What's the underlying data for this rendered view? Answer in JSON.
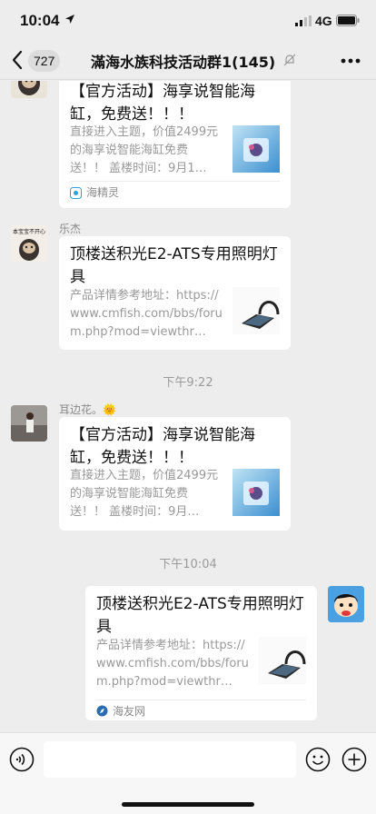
{
  "status_bar": {
    "time": "10:04",
    "network": "4G"
  },
  "header": {
    "back_count": "727",
    "title": "滿海水族科技活动群1(145)"
  },
  "messages": [
    {
      "type": "link_card",
      "title": "【官方活动】海享说智能海缸，免费送！！！",
      "description": "直接进入主题，价值2499元的海享说智能海缸免费送！！ 盖楼时间：9月1…",
      "source": "海精灵"
    },
    {
      "type": "link_card",
      "sender": "乐杰",
      "avatar_caption": "本宝宝不开心",
      "title": "顶楼送积光E2-ATS专用照明灯具",
      "description": "产品详情参考地址：https://www.cmfish.com/bbs/forum.php?mod=viewthr…"
    },
    {
      "type": "time",
      "text": "下午9:22"
    },
    {
      "type": "link_card",
      "sender": "耳边花。🌞",
      "title": "【官方活动】海享说智能海缸，免费送！！！",
      "description": "直接进入主题，价值2499元的海享说智能海缸免费送！！ 盖楼时间：9月…"
    },
    {
      "type": "time",
      "text": "下午10:04"
    },
    {
      "type": "link_card",
      "self": true,
      "title": "顶楼送积光E2-ATS专用照明灯具",
      "description": "产品详情参考地址：https://www.cmfish.com/bbs/forum.php?mod=viewthr…",
      "source": "海友网"
    }
  ],
  "input_bar": {
    "placeholder": ""
  },
  "colors": {
    "background": "#ededed",
    "bubble": "#ffffff",
    "accent": "#07c160"
  }
}
